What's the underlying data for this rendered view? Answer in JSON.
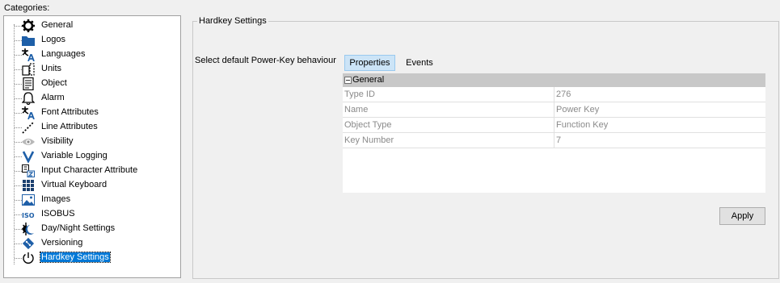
{
  "categories": {
    "label": "Categories:",
    "items": [
      {
        "label": "General",
        "icon": "gear-icon"
      },
      {
        "label": "Logos",
        "icon": "folder-icon"
      },
      {
        "label": "Languages",
        "icon": "translate-icon"
      },
      {
        "label": "Units",
        "icon": "units-icon"
      },
      {
        "label": "Object",
        "icon": "document-icon"
      },
      {
        "label": "Alarm",
        "icon": "bell-icon"
      },
      {
        "label": "Font Attributes",
        "icon": "font-icon"
      },
      {
        "label": "Line Attributes",
        "icon": "line-icon"
      },
      {
        "label": "Visibility",
        "icon": "eye-icon"
      },
      {
        "label": "Variable Logging",
        "icon": "v-icon"
      },
      {
        "label": "Input Character Attribute",
        "icon": "input-char-icon"
      },
      {
        "label": "Virtual Keyboard",
        "icon": "keyboard-icon"
      },
      {
        "label": "Images",
        "icon": "image-icon"
      },
      {
        "label": "ISOBUS",
        "icon": "iso-icon"
      },
      {
        "label": "Day/Night Settings",
        "icon": "day-night-icon"
      },
      {
        "label": "Versioning",
        "icon": "versioning-icon"
      },
      {
        "label": "Hardkey Settings",
        "icon": "power-icon",
        "selected": true
      }
    ]
  },
  "group": {
    "title": "Hardkey Settings",
    "behaviour_label": "Select default Power-Key behaviour"
  },
  "tabs": [
    {
      "label": "Properties",
      "active": true
    },
    {
      "label": "Events",
      "active": false
    }
  ],
  "property_grid": {
    "section": "General",
    "rows": [
      {
        "key": "Type ID",
        "value": "276"
      },
      {
        "key": "Name",
        "value": "Power Key"
      },
      {
        "key": "Object Type",
        "value": "Function Key"
      },
      {
        "key": "Key Number",
        "value": "7"
      }
    ]
  },
  "apply_label": "Apply",
  "colors": {
    "selection": "#0078d7",
    "icon_blue": "#1e5fa8",
    "tab_active_bg": "#cce4f7",
    "grid_header_bg": "#c8c8c8"
  }
}
